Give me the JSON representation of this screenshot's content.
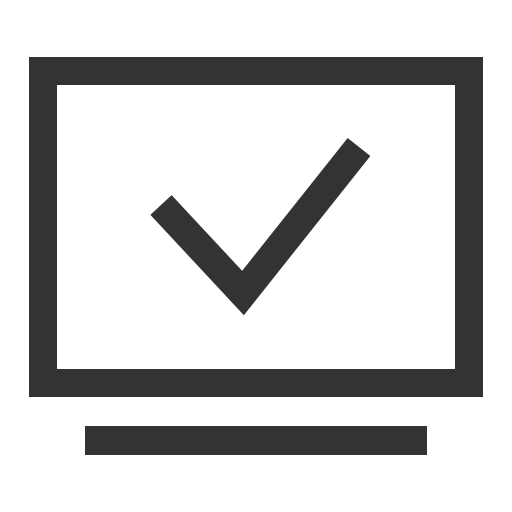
{
  "icon": {
    "name": "monitor-check-icon",
    "parts": {
      "screen": "monitor-screen-outline",
      "check": "checkmark",
      "stand": "monitor-stand-bar"
    }
  },
  "colors": {
    "background": "#ffffff",
    "stroke": "#333333"
  }
}
